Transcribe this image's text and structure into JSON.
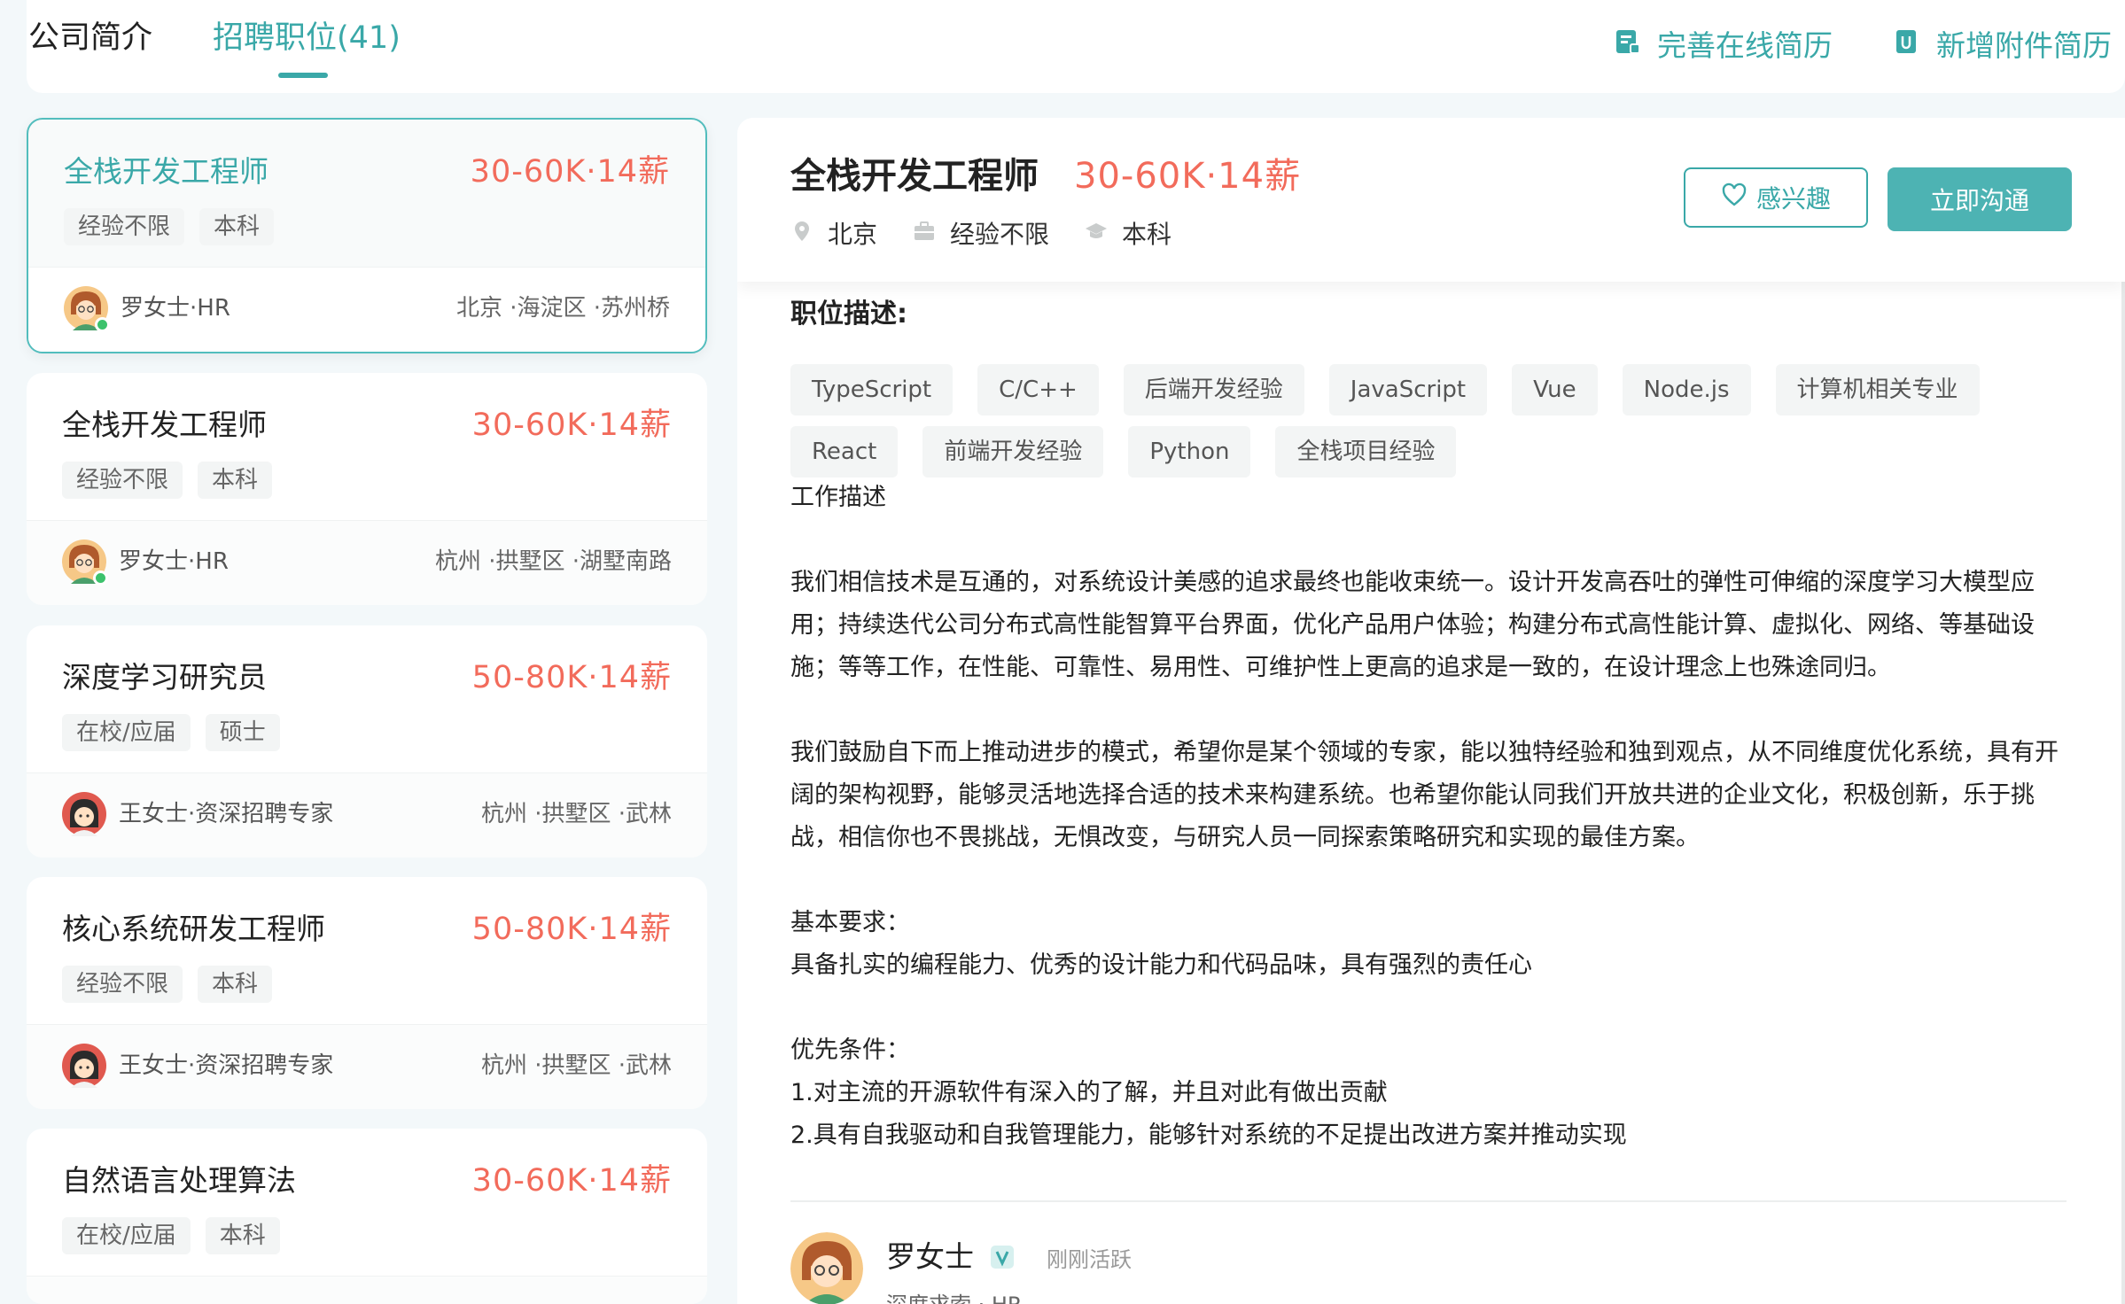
{
  "tabs": {
    "company": "公司简介",
    "jobs": "招聘职位(41)"
  },
  "actions": {
    "complete_resume": "完善在线简历",
    "add_attachment": "新增附件简历"
  },
  "jobs": [
    {
      "title": "全栈开发工程师",
      "salary": "30-60K·14薪",
      "tags": [
        "经验不限",
        "本科"
      ],
      "hr": "罗女士·HR",
      "location": "北京 ·海淀区 ·苏州桥"
    },
    {
      "title": "全栈开发工程师",
      "salary": "30-60K·14薪",
      "tags": [
        "经验不限",
        "本科"
      ],
      "hr": "罗女士·HR",
      "location": "杭州 ·拱墅区 ·湖墅南路"
    },
    {
      "title": "深度学习研究员",
      "salary": "50-80K·14薪",
      "tags": [
        "在校/应届",
        "硕士"
      ],
      "hr": "王女士·资深招聘专家",
      "location": "杭州 ·拱墅区 ·武林"
    },
    {
      "title": "核心系统研发工程师",
      "salary": "50-80K·14薪",
      "tags": [
        "经验不限",
        "本科"
      ],
      "hr": "王女士·资深招聘专家",
      "location": "杭州 ·拱墅区 ·武林"
    },
    {
      "title": "自然语言处理算法",
      "salary": "30-60K·14薪",
      "tags": [
        "在校/应届",
        "本科"
      ]
    }
  ],
  "detail": {
    "title": "全栈开发工程师",
    "salary": "30-60K·14薪",
    "city": "北京",
    "experience": "经验不限",
    "education": "本科",
    "btn_interest": "感兴趣",
    "btn_chat": "立即沟通",
    "section_title": "职位描述:",
    "skills": [
      "TypeScript",
      "C/C++",
      "后端开发经验",
      "JavaScript",
      "Vue",
      "Node.js",
      "计算机相关专业",
      "React",
      "前端开发经验",
      "Python",
      "全栈项目经验"
    ],
    "description": "工作描述\n\n我们相信技术是互通的，对系统设计美感的追求最终也能收束统一。设计开发高吞吐的弹性可伸缩的深度学习大模型应用；持续迭代公司分布式高性能智算平台界面，优化产品用户体验；构建分布式高性能计算、虚拟化、网络、等基础设施；等等工作，在性能、可靠性、易用性、可维护性上更高的追求是一致的，在设计理念上也殊途同归。\n\n我们鼓励自下而上推动进步的模式，希望你是某个领域的专家，能以独特经验和独到观点，从不同维度优化系统，具有开阔的架构视野，能够灵活地选择合适的技术来构建系统。也希望你能认同我们开放共进的企业文化，积极创新，乐于挑战，相信你也不畏挑战，无惧改变，与研究人员一同探索策略研究和实现的最佳方案。\n\n基本要求：\n具备扎实的编程能力、优秀的设计能力和代码品味，具有强烈的责任心\n\n优先条件：\n1.对主流的开源软件有深入的了解，并且对此有做出贡献\n2.具有自我驱动和自我管理能力，能够针对系统的不足提出改进方案并推动实现",
    "recruiter": {
      "name": "罗女士",
      "status": "刚刚活跃",
      "subtitle": "深度求索 · HR"
    }
  },
  "colors": {
    "accent": "#3aa8a8",
    "salary": "#f26b5b",
    "online": "#3cc26c"
  }
}
